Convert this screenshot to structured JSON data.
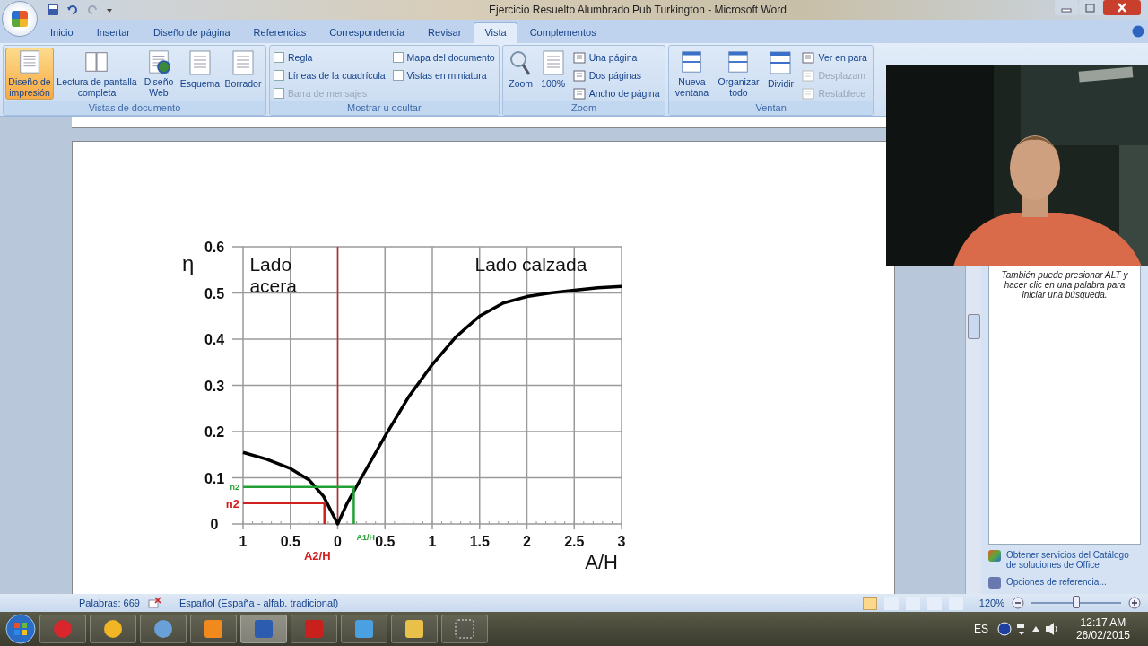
{
  "window": {
    "title": "Ejercicio Resuelto Alumbrado Pub Turkington - Microsoft Word"
  },
  "tabs": [
    {
      "label": "Inicio",
      "selected": false
    },
    {
      "label": "Insertar",
      "selected": false
    },
    {
      "label": "Diseño de página",
      "selected": false
    },
    {
      "label": "Referencias",
      "selected": false
    },
    {
      "label": "Correspondencia",
      "selected": false
    },
    {
      "label": "Revisar",
      "selected": false
    },
    {
      "label": "Vista",
      "selected": true
    },
    {
      "label": "Complementos",
      "selected": false
    }
  ],
  "ribbon": [
    {
      "label": "Vistas de documento",
      "items": [
        {
          "kind": "large",
          "label": "Diseño de impresión",
          "selected": true
        },
        {
          "kind": "large",
          "label": "Lectura de pantalla completa",
          "selected": false
        },
        {
          "kind": "large",
          "label": "Diseño Web",
          "selected": false
        },
        {
          "kind": "large",
          "label": "Esquema",
          "selected": false
        },
        {
          "kind": "large",
          "label": "Borrador",
          "selected": false
        }
      ]
    },
    {
      "label": "Mostrar u ocultar",
      "items": [
        {
          "kind": "check",
          "label": "Regla",
          "checked": false,
          "disabled": false
        },
        {
          "kind": "check",
          "label": "Líneas de la cuadrícula",
          "checked": false,
          "disabled": false
        },
        {
          "kind": "check",
          "label": "Barra de mensajes",
          "checked": false,
          "disabled": true
        },
        {
          "kind": "check",
          "label": "Mapa del documento",
          "checked": false,
          "disabled": false
        },
        {
          "kind": "check",
          "label": "Vistas en miniatura",
          "checked": false,
          "disabled": false
        }
      ]
    },
    {
      "label": "Zoom",
      "items": [
        {
          "kind": "large",
          "label": "Zoom",
          "selected": false
        },
        {
          "kind": "large",
          "label": "100%",
          "selected": false
        },
        {
          "kind": "small",
          "label": "Una página",
          "disabled": false
        },
        {
          "kind": "small",
          "label": "Dos páginas",
          "disabled": false
        },
        {
          "kind": "small",
          "label": "Ancho de página",
          "disabled": false
        }
      ]
    },
    {
      "label": "Ventan",
      "items": [
        {
          "kind": "large",
          "label": "Nueva ventana",
          "selected": false
        },
        {
          "kind": "large",
          "label": "Organizar todo",
          "selected": false
        },
        {
          "kind": "large",
          "label": "Dividir",
          "selected": false
        },
        {
          "kind": "small",
          "label": "Ver en para",
          "disabled": false
        },
        {
          "kind": "small",
          "label": "Desplazam",
          "disabled": true
        },
        {
          "kind": "small",
          "label": "Restablece",
          "disabled": true
        }
      ]
    }
  ],
  "document": {
    "chart_data": {
      "type": "line",
      "xlabel": "A/H",
      "ylabel": "η",
      "x": [
        -1,
        -0.75,
        -0.5,
        -0.3,
        -0.15,
        0,
        0.1,
        0.25,
        0.5,
        0.75,
        1,
        1.25,
        1.5,
        1.75,
        2,
        2.25,
        2.5,
        2.75,
        3
      ],
      "series": [
        {
          "color": "#000000",
          "values": [
            0.155,
            0.14,
            0.12,
            0.095,
            0.06,
            0,
            0.045,
            0.1,
            0.19,
            0.275,
            0.345,
            0.405,
            0.45,
            0.478,
            0.492,
            0.5,
            0.506,
            0.511,
            0.514
          ]
        }
      ],
      "xlim": [
        -1,
        3
      ],
      "ylim": [
        0,
        0.6
      ],
      "xticks": [
        {
          "value": -1,
          "label": "1"
        },
        {
          "value": -0.5,
          "label": "0.5"
        },
        {
          "value": 0,
          "label": "0"
        },
        {
          "value": 0.5,
          "label": "0.5"
        },
        {
          "value": 1,
          "label": "1"
        },
        {
          "value": 1.5,
          "label": "1.5"
        },
        {
          "value": 2,
          "label": "2"
        },
        {
          "value": 2.5,
          "label": "2.5"
        },
        {
          "value": 3,
          "label": "3"
        }
      ],
      "yticks": [
        0,
        0.1,
        0.2,
        0.3,
        0.4,
        0.5,
        0.6
      ],
      "grid": true,
      "ref_lines": [
        {
          "axis": "x",
          "value": 0,
          "color": "#cc2222"
        }
      ],
      "annotations": [
        "Lado acera",
        "Lado calzada",
        "n2",
        "A1/H",
        "n2",
        "A2/H"
      ]
    }
  },
  "task_pane": {
    "text": "También puede presionar ALT y hacer clic en una palabra para iniciar una búsqueda.",
    "links": [
      "Obtener servicios del Catálogo de soluciones de Office",
      "Opciones de referencia..."
    ]
  },
  "status_bar": {
    "words": "Palabras: 669",
    "language": "Español (España - alfab. tradicional)",
    "views": [
      {
        "selected": true
      },
      {
        "selected": false
      },
      {
        "selected": false
      },
      {
        "selected": false
      },
      {
        "selected": false
      }
    ],
    "zoom": "120%",
    "zoom_slider": {
      "level": 0.5
    }
  },
  "taskbar": {
    "apps": [
      {
        "active": false
      },
      {
        "active": false
      },
      {
        "active": false
      },
      {
        "active": false
      },
      {
        "active": true
      },
      {
        "active": false
      },
      {
        "active": false
      },
      {
        "active": false
      },
      {
        "active": false
      }
    ],
    "language": "ES",
    "time": "12:17 AM",
    "date": "26/02/2015"
  }
}
